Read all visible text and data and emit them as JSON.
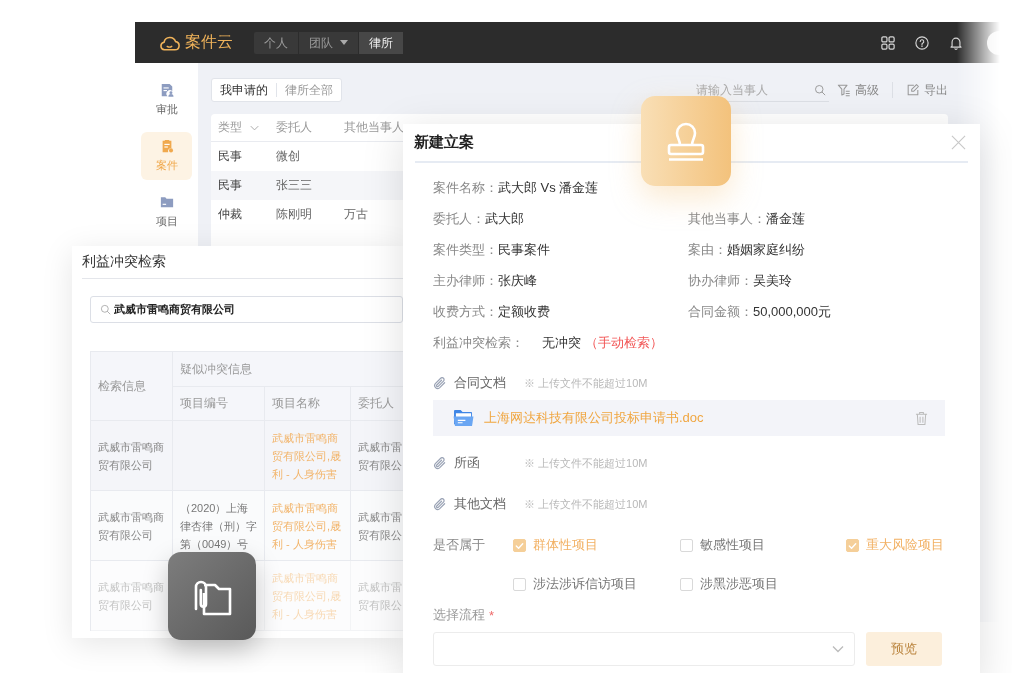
{
  "app": {
    "brand": "案件云",
    "nav": [
      {
        "label": "个人",
        "selected": false,
        "dropdown": false
      },
      {
        "label": "团队",
        "selected": false,
        "dropdown": true
      },
      {
        "label": "律所",
        "selected": true,
        "dropdown": false
      }
    ],
    "sidebar": [
      {
        "label": "审批",
        "selected": false
      },
      {
        "label": "案件",
        "selected": true
      },
      {
        "label": "项目",
        "selected": false
      }
    ],
    "filter_tabs": [
      {
        "label": "我申请的",
        "selected": true
      },
      {
        "label": "律所全部",
        "selected": false
      }
    ],
    "search": {
      "placeholder": "请输入当事人"
    },
    "actions": [
      {
        "label": "高级"
      },
      {
        "label": "导出"
      }
    ],
    "table": {
      "columns": [
        {
          "label": "类型",
          "dropdown": true
        },
        {
          "label": "委托人",
          "dropdown": false
        },
        {
          "label": "其他当事人",
          "dropdown": false
        }
      ],
      "rows": [
        [
          "民事",
          "微创"
        ],
        [
          "民事",
          "张三三"
        ],
        [
          "仲裁",
          "陈刚明",
          "万古"
        ]
      ]
    }
  },
  "conflict_search": {
    "title": "利益冲突检索",
    "query": "武威市雷鸣商贸有限公司",
    "table": {
      "first_column": "检索信息",
      "group_header": "疑似冲突信息",
      "columns": [
        "项目编号",
        "项目名称",
        "委托人"
      ],
      "rows": [
        {
          "query": [
            "武威市雷鸣商",
            "贸有限公司"
          ],
          "project_name": [
            "武威市雷鸣商",
            "贸有限公司,晟",
            "利 - 人身伤害"
          ],
          "client": [
            "武威市雷",
            "贸有限公"
          ]
        },
        {
          "query": [
            "武威市雷鸣商",
            "贸有限公司"
          ],
          "project_no": [
            "（2020）上海",
            "律杏律（刑）字",
            "第（0049）号"
          ],
          "project_name": [
            "武威市雷鸣商",
            "贸有限公司,晟",
            "利 - 人身伤害"
          ],
          "client": [
            "武威市雷",
            "贸有限公"
          ]
        },
        {
          "query": [
            "武威市雷鸣商",
            "贸有限公司"
          ],
          "project_name": [
            "武威市雷鸣商",
            "贸有限公司,晟",
            "利 - 人身伤害"
          ],
          "client": [
            "武威市雷",
            "贸有限公"
          ]
        }
      ]
    }
  },
  "dialog": {
    "title": "新建立案",
    "case_name": {
      "label": "案件名称：",
      "value": "武大郎 Vs 潘金莲"
    },
    "fields": [
      {
        "label": "委托人：",
        "value": "武大郎"
      },
      {
        "label": "其他当事人：",
        "value": "潘金莲"
      },
      {
        "label": "案件类型：",
        "value": "民事案件"
      },
      {
        "label": "案由：",
        "value": "婚姻家庭纠纷"
      },
      {
        "label": "主办律师：",
        "value": "张庆峰"
      },
      {
        "label": "协办律师：",
        "value": "吴美玲"
      },
      {
        "label": "收费方式：",
        "value": "定额收费"
      },
      {
        "label": "合同金额：",
        "value": "50,000,000元"
      }
    ],
    "conflict_check": {
      "label": "利益冲突检索：",
      "value": "无冲突",
      "link": "（手动检索）"
    },
    "attachments": [
      {
        "label": "合同文档",
        "note": "※ 上传文件不能超过10M",
        "files": [
          "上海网达科技有限公司投标申请书.doc"
        ]
      },
      {
        "label": "所函",
        "note": "※ 上传文件不能超过10M"
      },
      {
        "label": "其他文档",
        "note": "※ 上传文件不能超过10M"
      }
    ],
    "categories": {
      "label": "是否属于",
      "options": [
        {
          "label": "群体性项目",
          "checked": true
        },
        {
          "label": "敏感性项目",
          "checked": false
        },
        {
          "label": "重大风险项目",
          "checked": true
        },
        {
          "label": "涉法涉诉信访项目",
          "checked": false
        },
        {
          "label": "涉黑涉恶项目",
          "checked": false
        }
      ]
    },
    "workflow": {
      "label": "选择流程",
      "required_mark": "*",
      "button": "预览"
    }
  }
}
